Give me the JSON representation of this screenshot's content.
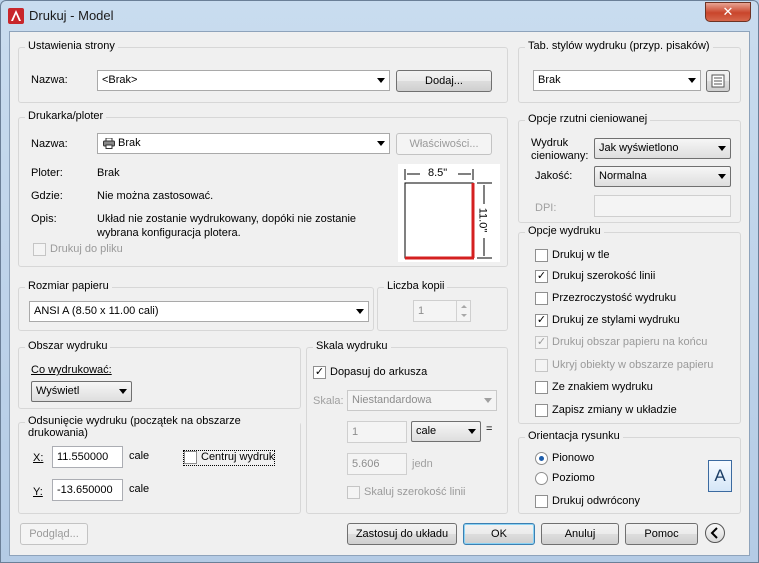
{
  "window": {
    "title": "Drukuj - Model",
    "close_label": "✕"
  },
  "page_setup": {
    "title": "Ustawienia strony",
    "name_label": "Nazwa:",
    "name_value": "<Brak>",
    "add_button": "Dodaj..."
  },
  "printer": {
    "title": "Drukarka/ploter",
    "name_label": "Nazwa:",
    "name_value": "Brak",
    "properties_button": "Właściwości...",
    "plotter_label": "Ploter:",
    "plotter_value": "Brak",
    "where_label": "Gdzie:",
    "where_value": "Nie można zastosować.",
    "desc_label": "Opis:",
    "desc_line1": "Układ nie zostanie wydrukowany, dopóki nie zostanie",
    "desc_line2": "wybrana konfiguracja plotera.",
    "print_to_file": "Drukuj do pliku",
    "preview_width": "8.5\"",
    "preview_height": "11.0\""
  },
  "paper_size": {
    "title": "Rozmiar papieru",
    "value": "ANSI A (8.50 x 11.00 cali)"
  },
  "copies": {
    "title": "Liczba kopii",
    "value": "1"
  },
  "plot_area": {
    "title": "Obszar wydruku",
    "what_label": "Co wydrukować:",
    "what_value": "Wyświetl"
  },
  "plot_offset": {
    "title": "Odsunięcie wydruku (początek na obszarze drukowania)",
    "x_label": "X:",
    "x_value": "11.550000",
    "x_unit": "cale",
    "y_label": "Y:",
    "y_value": "-13.650000",
    "y_unit": "cale",
    "center_label": "Centruj wydruk"
  },
  "plot_scale": {
    "title": "Skala wydruku",
    "fit_label": "Dopasuj do arkusza",
    "scale_label": "Skala:",
    "scale_value": "Niestandardowa",
    "value1": "1",
    "unit1": "cale",
    "equals": "=",
    "value2": "5.606",
    "unit2": "jedn",
    "lineweights_label": "Skaluj szerokość linii"
  },
  "style_table": {
    "title": "Tab. stylów wydruku (przyp. pisaków)",
    "value": "Brak"
  },
  "shaded": {
    "title": "Opcje rzutni cieniowanej",
    "shade_label_1": "Wydruk",
    "shade_label_2": "cieniowany:",
    "shade_value": "Jak wyświetlono",
    "quality_label": "Jakość:",
    "quality_value": "Normalna",
    "dpi_label": "DPI:"
  },
  "options": {
    "title": "Opcje wydruku",
    "items": [
      {
        "label": "Drukuj w tle",
        "checked": false,
        "enabled": true
      },
      {
        "label": "Drukuj szerokość linii",
        "checked": true,
        "enabled": true
      },
      {
        "label": "Przezroczystość wydruku",
        "checked": false,
        "enabled": true
      },
      {
        "label": "Drukuj ze stylami wydruku",
        "checked": true,
        "enabled": true
      },
      {
        "label": "Drukuj obszar papieru na końcu",
        "checked": true,
        "enabled": false
      },
      {
        "label": "Ukryj obiekty w obszarze papieru",
        "checked": false,
        "enabled": false
      },
      {
        "label": "Ze znakiem wydruku",
        "checked": false,
        "enabled": true
      },
      {
        "label": "Zapisz zmiany w układzie",
        "checked": false,
        "enabled": true
      }
    ]
  },
  "orientation": {
    "title": "Orientacja rysunku",
    "portrait": "Pionowo",
    "landscape": "Poziomo",
    "upside_down": "Drukuj odwrócony",
    "icon_letter": "A"
  },
  "footer": {
    "preview": "Podgląd...",
    "apply": "Zastosuj do układu",
    "ok": "OK",
    "cancel": "Anuluj",
    "help": "Pomoc"
  },
  "colors": {
    "accent": "#1d5dab",
    "preview_red": "#d42020",
    "close": "#c9452b"
  }
}
